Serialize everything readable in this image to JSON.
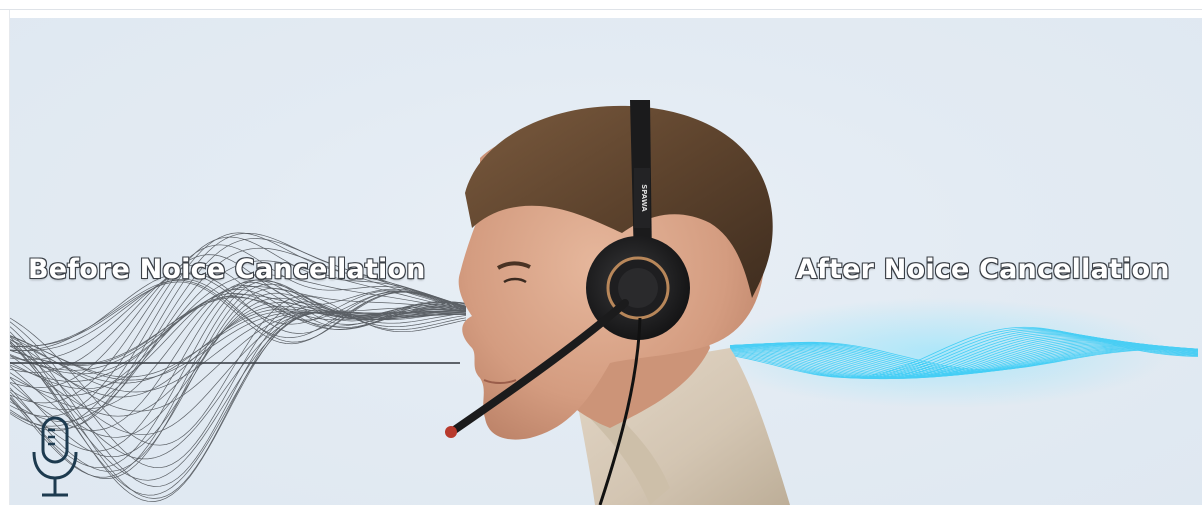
{
  "headlines": {
    "before": "Before Noice Cancellation",
    "after": "After Noice Cancellation"
  },
  "headset_brand": "SPAWA",
  "icons": {
    "microphone": "microphone-icon"
  },
  "colors": {
    "background": "#e3ebf3",
    "noise_wave": "#2e3237",
    "clean_wave": "#27c8f5",
    "headline_fill": "#ffffff",
    "headline_outline": "#3a3f46",
    "mic_icon": "#1d3a4f",
    "headset": "#1b1b1c",
    "shirt": "#d9cdbd"
  }
}
